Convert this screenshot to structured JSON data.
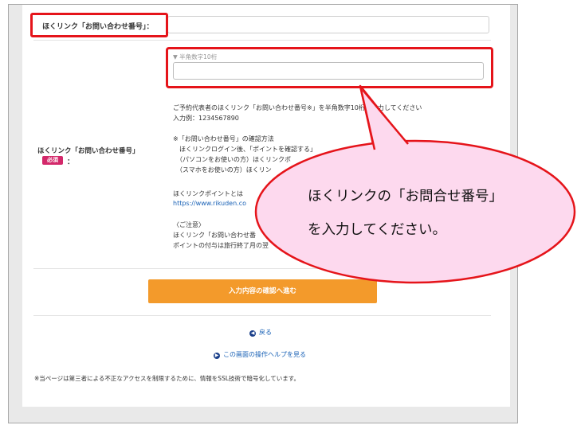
{
  "form": {
    "top_field_label": "ほくリンク「お問い合わせ番号」：",
    "field_label": "ほくリンク「お問い合わせ番号」",
    "required_badge": "必須",
    "required_colon": "：",
    "input_hint": "▼ 半角数字10桁",
    "input_value": "",
    "description_lines": [
      "ご予約代表者のほくリンク「お問い合わせ番号※」を半角数字10桁で入力してください",
      "入力例：1234567890",
      "",
      "※「お問い合わせ番号」の確認方法",
      "　ほくリンクログイン後、「ポイントを確認する」",
      "　（パソコンをお使いの方）ほくリンクポ",
      "　（スマホをお使いの方）ほくリン",
      "",
      "ほくリンクポイントとは",
      "https://www.rikuden.co",
      "",
      "〈ご注意〉",
      "ほくリンク「お問い合わせ番",
      "ポイントの付与は旅行終了月の翌"
    ],
    "submit_label": "入力内容の確認へ進む",
    "back_label": "戻る",
    "help_label": "この画面の操作ヘルプを見る",
    "footer_note": "※当ページは第三者による不正なアクセスを制限するために、情報をSSL技術で暗号化しています。"
  },
  "callout": {
    "line1": "ほくリンクの「お問合せ番号」",
    "line2": "を入力してください。"
  },
  "colors": {
    "highlight": "#e5141a",
    "callout_fill": "#fdd9ee",
    "submit": "#f39a2b",
    "link": "#1a62b6",
    "required_badge": "#d3286a"
  }
}
